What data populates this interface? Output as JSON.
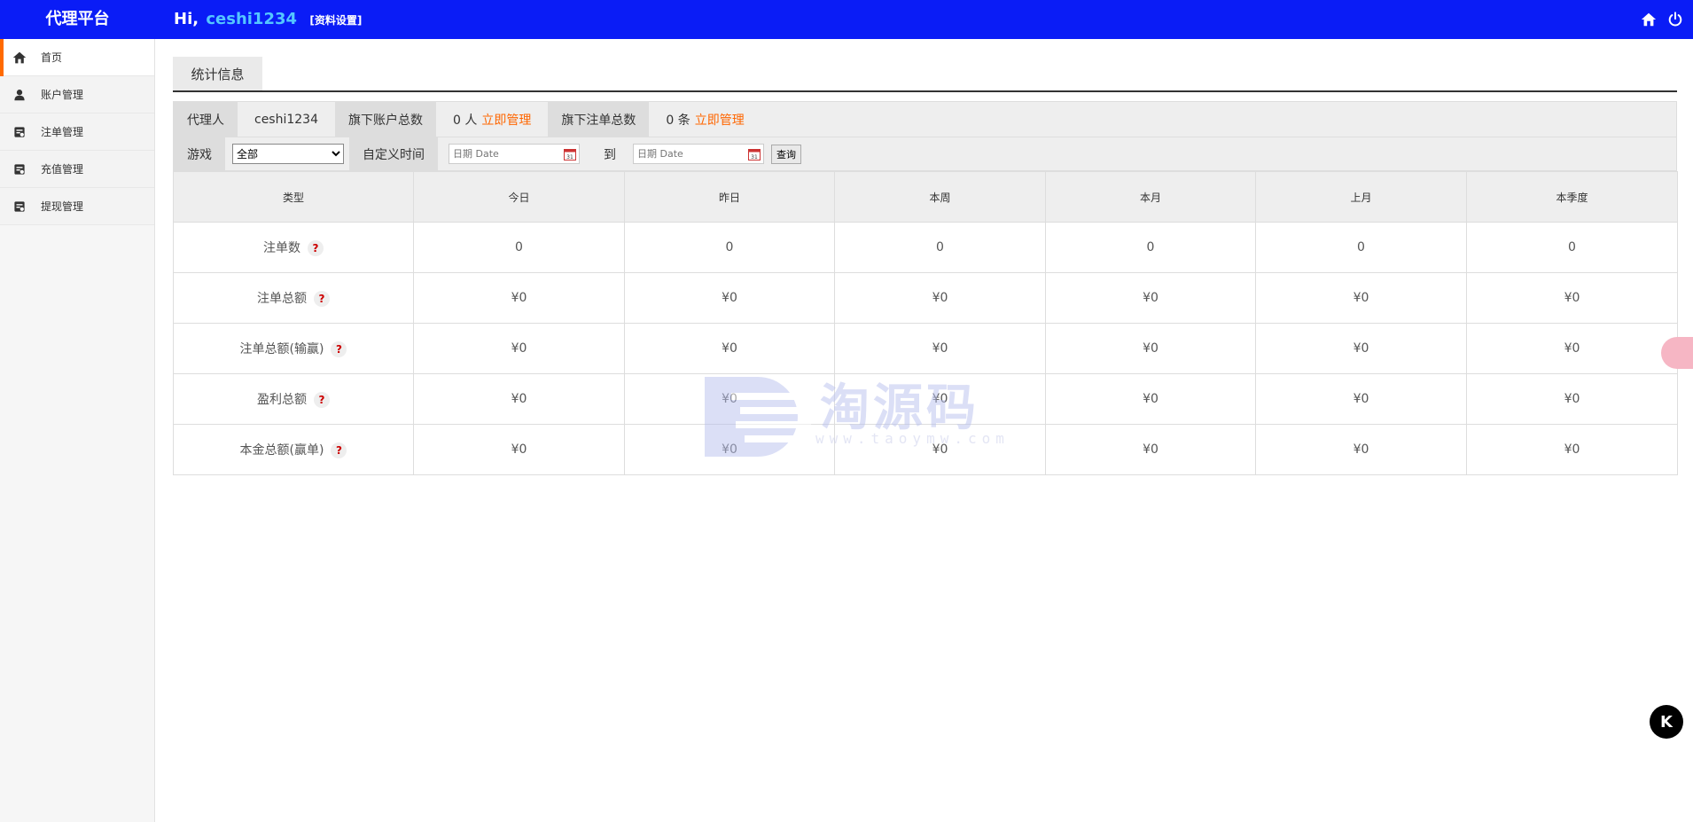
{
  "header": {
    "brand": "代理平台",
    "greeting": "Hi,",
    "username": "ceshi1234",
    "profile_link": "[资料设置]"
  },
  "sidebar": {
    "items": [
      {
        "label": "首页",
        "icon": "home-icon"
      },
      {
        "label": "账户管理",
        "icon": "user-icon"
      },
      {
        "label": "注单管理",
        "icon": "ledger-icon"
      },
      {
        "label": "充值管理",
        "icon": "ledger-icon"
      },
      {
        "label": "提现管理",
        "icon": "ledger-icon"
      }
    ]
  },
  "tabs": {
    "active": "统计信息"
  },
  "info": {
    "agent_label": "代理人",
    "agent_value": "ceshi1234",
    "accounts_label": "旗下账户总数",
    "accounts_value": "0 人",
    "accounts_link": "立即管理",
    "bets_label": "旗下注单总数",
    "bets_value": "0 条",
    "bets_link": "立即管理"
  },
  "filter": {
    "game_label": "游戏",
    "game_selected": "全部",
    "time_label": "自定义时间",
    "date_placeholder": "日期 Date",
    "to_label": "到",
    "query_button": "查询"
  },
  "table": {
    "headers": [
      "类型",
      "今日",
      "昨日",
      "本周",
      "本月",
      "上月",
      "本季度"
    ],
    "rows": [
      {
        "label": "注单数",
        "values": [
          "0",
          "0",
          "0",
          "0",
          "0",
          "0"
        ]
      },
      {
        "label": "注单总额",
        "values": [
          "¥0",
          "¥0",
          "¥0",
          "¥0",
          "¥0",
          "¥0"
        ]
      },
      {
        "label": "注单总额(输赢)",
        "values": [
          "¥0",
          "¥0",
          "¥0",
          "¥0",
          "¥0",
          "¥0"
        ]
      },
      {
        "label": "盈利总额",
        "values": [
          "¥0",
          "¥0",
          "¥0",
          "¥0",
          "¥0",
          "¥0"
        ]
      },
      {
        "label": "本金总额(赢单)",
        "values": [
          "¥0",
          "¥0",
          "¥0",
          "¥0",
          "¥0",
          "¥0"
        ]
      }
    ],
    "help_mark": "?"
  },
  "watermark": {
    "text": "淘源码",
    "url": "www.taoymw.com"
  },
  "floating": {
    "k_label": "K"
  },
  "colors": {
    "header_bg": "#0a1cf6",
    "username": "#54c6ff",
    "accent": "#ff6600",
    "active_marker": "#ff6a00"
  }
}
